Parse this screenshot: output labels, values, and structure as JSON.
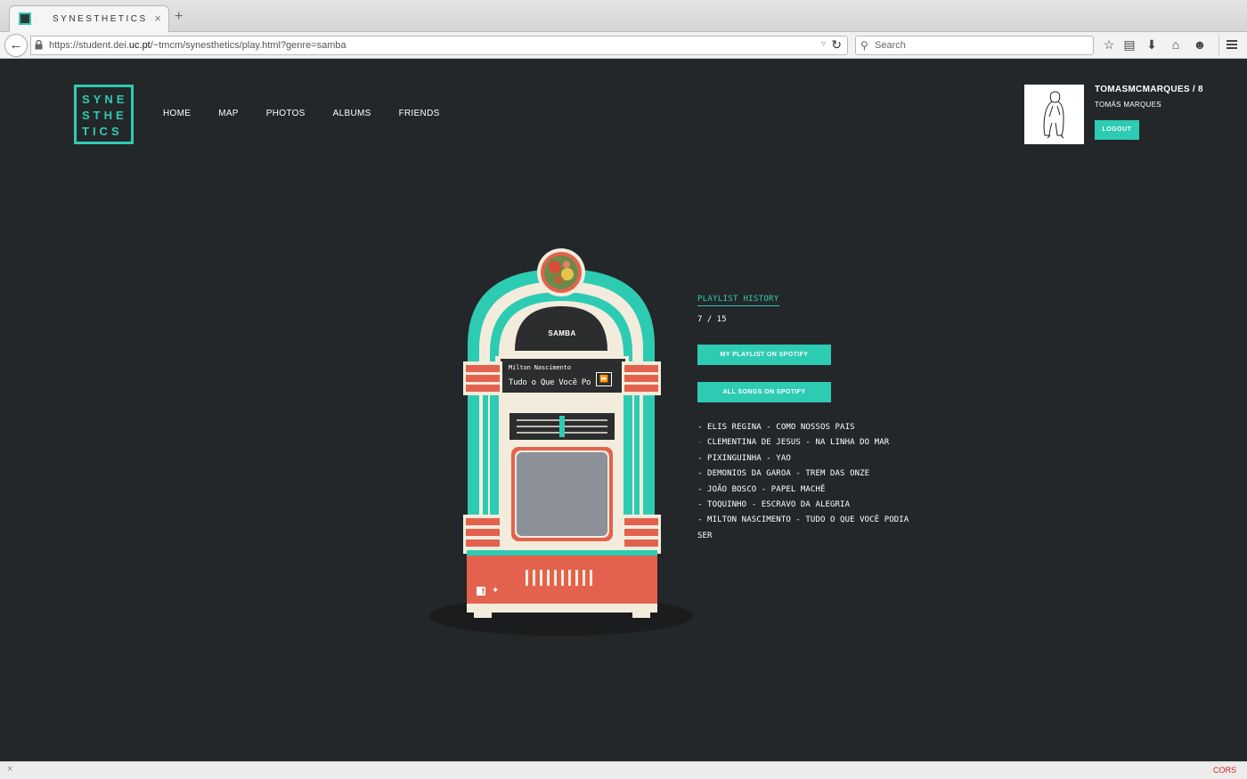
{
  "browser": {
    "tab_title": "SYNESTHETICS",
    "tab_close": "×",
    "new_tab": "+",
    "url_prefix": "https://student.dei.",
    "url_domain": "uc.pt",
    "url_suffix": "/~tmcm/synesthetics/play.html?genre=samba",
    "search_placeholder": "Search",
    "status_right": "CORS"
  },
  "site": {
    "logo_lines": [
      "SYNE",
      "STHE",
      "TICS"
    ],
    "nav": [
      "HOME",
      "MAP",
      "PHOTOS",
      "ALBUMS",
      "FRIENDS"
    ]
  },
  "user": {
    "username": "TOMASMCMARQUES / 8",
    "real_name": "TOMÁS MARQUES",
    "logout_label": "LOGOUT"
  },
  "jukebox": {
    "genre": "SAMBA",
    "artist": "Milton Nascimento",
    "track": "Tudo o Que Você Po",
    "next_icon": "fast-forward-icon",
    "share_facebook_icon": "facebook-icon",
    "share_twitter_icon": "twitter-icon",
    "colors": {
      "teal": "#2ecbb3",
      "cream": "#f3ecdc",
      "coral": "#e3624d",
      "dark": "#2b2d2f",
      "screen": "#8b9099"
    }
  },
  "playlist": {
    "history_label": "PLAYLIST HISTORY",
    "counter": "7 / 15",
    "spotify_mine": "MY PLAYLIST ON SPOTIFY",
    "spotify_all": "ALL SONGS ON SPOTIFY",
    "items": [
      "ELIS REGINA - COMO NOSSOS PAIS",
      "CLEMENTINA DE JESUS - NA LINHA DO MAR",
      "PIXINGUINHA - YAO",
      "DEMONIOS DA GAROA - TREM DAS ONZE",
      "JOÃO BOSCO - PAPEL MACHÊ",
      "TOQUINHO - ESCRAVO DA ALEGRIA",
      "MILTON NASCIMENTO - TUDO O QUE VOCÊ PODIA SER"
    ],
    "current_index": 1
  }
}
